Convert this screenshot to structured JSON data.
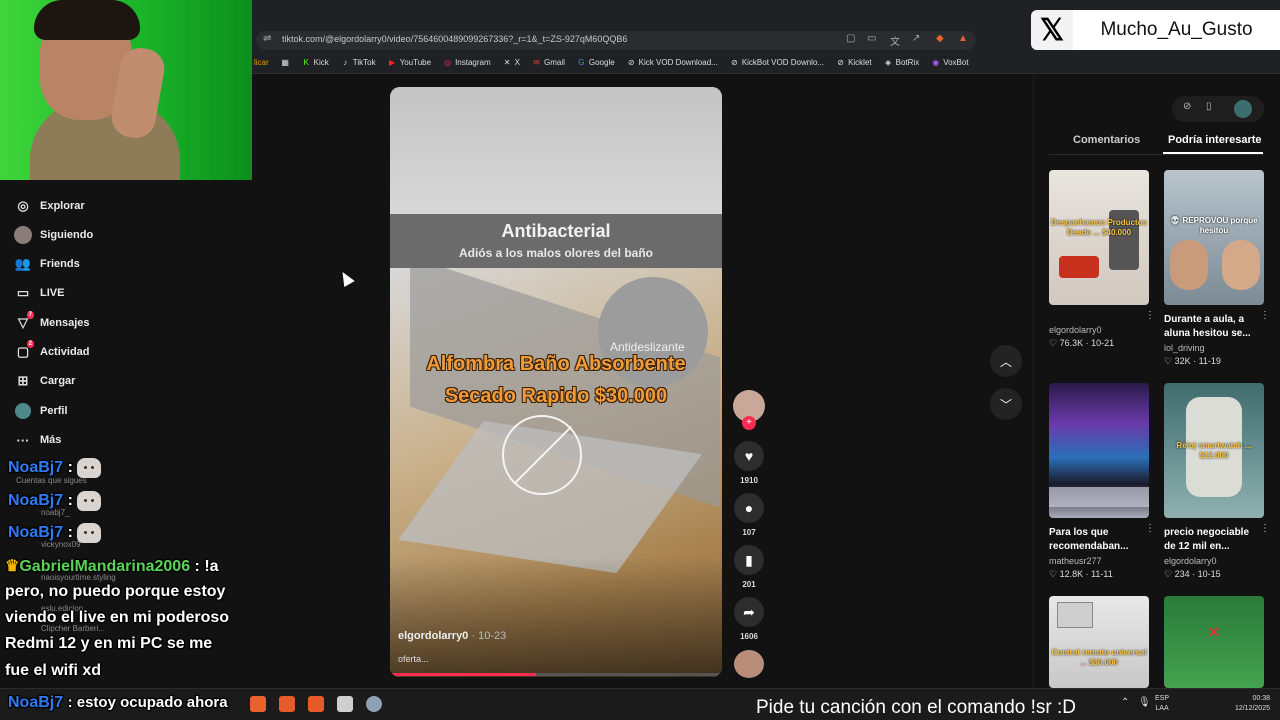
{
  "browser": {
    "url": "tiktok.com/@elgordolarry0/video/7564600489099267336?_r=1&_t=ZS-927qM60QQB6",
    "bookmarks": [
      {
        "label": "licar",
        "icon": "grid-icon"
      },
      {
        "label": "Kick",
        "icon": "kick-icon"
      },
      {
        "label": "TikTok",
        "icon": "tiktok-icon"
      },
      {
        "label": "YouTube",
        "icon": "youtube-icon"
      },
      {
        "label": "Instagram",
        "icon": "instagram-icon"
      },
      {
        "label": "X",
        "icon": "x-icon"
      },
      {
        "label": "Gmail",
        "icon": "gmail-icon"
      },
      {
        "label": "Google",
        "icon": "google-icon"
      },
      {
        "label": "Kick VOD Download...",
        "icon": "kick-vod-icon"
      },
      {
        "label": "KickBot VOD Downlo...",
        "icon": "kickbot-icon"
      },
      {
        "label": "Kicklet",
        "icon": "kicklet-icon"
      },
      {
        "label": "BotRix",
        "icon": "botrix-icon"
      },
      {
        "label": "VoxBot",
        "icon": "voxbot-icon"
      }
    ]
  },
  "overlay": {
    "x_username": "Mucho_Au_Gusto",
    "marquee": "Pide tu canción con el comando !sr :D"
  },
  "sidebar": {
    "items": [
      {
        "label": "Explorar",
        "icon": "compass-icon"
      },
      {
        "label": "Siguiendo",
        "icon": "following-avatar"
      },
      {
        "label": "Friends",
        "icon": "friends-icon"
      },
      {
        "label": "LIVE",
        "icon": "live-icon"
      },
      {
        "label": "Mensajes",
        "icon": "messages-icon",
        "badge": "7"
      },
      {
        "label": "Actividad",
        "icon": "activity-icon",
        "badge": "2"
      },
      {
        "label": "Cargar",
        "icon": "upload-icon"
      },
      {
        "label": "Perfil",
        "icon": "profile-avatar"
      },
      {
        "label": "Más",
        "icon": "more-icon"
      }
    ],
    "following_heading": "Cuentas que sigues",
    "following": [
      "noabj7_",
      "vickynox09",
      "naoisyourtime.styling",
      "eslu.edicion",
      "Clipcher Barberi..."
    ]
  },
  "chat": [
    {
      "user": "NoaBj7",
      "text": ":",
      "emote": true
    },
    {
      "user": "NoaBj7",
      "text": ":",
      "emote": true
    },
    {
      "user": "NoaBj7",
      "text": ":",
      "emote": true
    },
    {
      "user": "GabrielMandarina2006",
      "text": ": !a",
      "crown": true
    },
    {
      "line": "pero, no puedo porque estoy"
    },
    {
      "line": "viendo el live en mi poderoso"
    },
    {
      "line": "Redmi 12 y en mi PC se me"
    },
    {
      "line": "fue el wifi xd"
    },
    {
      "user": "NoaBj7",
      "text": ": estoy ocupado ahora"
    }
  ],
  "video": {
    "headline": "Antibacterial",
    "subline": "Adiós a los malos olores del baño",
    "badge": "Antideslizante",
    "line1": "Alfombra Baño Absorbente",
    "line2": "Secado Rapido $30.000",
    "author": "elgordolarry0",
    "date": " · 10-23",
    "description": "oferta...",
    "progress": 0.44
  },
  "actions": {
    "likes": "1910",
    "comments": "107",
    "saves": "201",
    "shares": "1606"
  },
  "right_panel": {
    "tabs": [
      "Comentarios",
      "Podría interesarte"
    ],
    "cards": [
      {
        "title": "",
        "author": "elgordolarry0",
        "stats": "♡ 76.3K · 10-21",
        "overlay": "Despachamos Productos Desde ... $40.000"
      },
      {
        "title": "Durante a aula, a aluna hesitou se...",
        "author": "lol_driving",
        "stats": "♡ 32K · 11-19",
        "overlay": "💀 REPROVOU porque hesitou"
      },
      {
        "title": "Para los que recomendaban...",
        "author": "matheusr277",
        "stats": "♡ 12.8K · 11-11",
        "overlay": ""
      },
      {
        "title": "precio negociable de 12 mil en...",
        "author": "elgordolarry0",
        "stats": "♡ 234 · 10-15",
        "overlay": "Reloj smartwatch ... $12.000"
      },
      {
        "title": "",
        "author": "",
        "stats": "",
        "overlay": "Control remoto universal ... $30.000"
      },
      {
        "title": "",
        "author": "",
        "stats": "",
        "overlay": ""
      }
    ]
  },
  "taskbar": {
    "lang1": "ESP",
    "lang2": "LAA",
    "time": "00:38",
    "date": "12/12/2025"
  }
}
